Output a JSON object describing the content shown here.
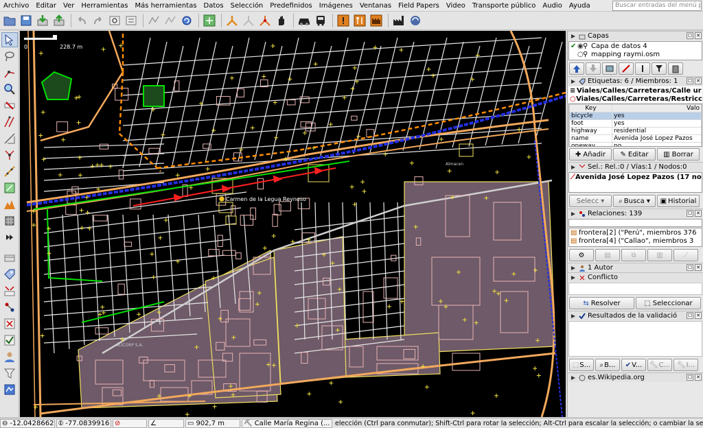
{
  "menubar": {
    "items": [
      "Archivo",
      "Editar",
      "Ver",
      "Herramientas",
      "Más herramientas",
      "Datos",
      "Selección",
      "Predefinidos",
      "Imágenes",
      "Ventanas",
      "Field Papers",
      "Video",
      "Transporte público",
      "Audio",
      "Ayuda"
    ],
    "search_placeholder": "Buscar entradas del menú p"
  },
  "map": {
    "scale_left": "0",
    "scale_right": "228.7 m",
    "labels": {
      "place": "Carmen de la Legua Reynoso",
      "company": "ALICORP S.A.",
      "shop": "Almacen"
    }
  },
  "panels": {
    "layers": {
      "title": "Capas",
      "items": [
        "Capa de datos 4",
        "mapping raymi.osm"
      ]
    },
    "tags": {
      "title": "Etiquetas: 6 / Miembros: 1",
      "presets": [
        "Viales/Calles/Carreteras/Calle ur",
        "Viales/Calles/Carreteras/Restricc"
      ],
      "col_key": "Key",
      "col_value": "Valo",
      "rows": [
        {
          "k": "bicycle",
          "v": "yes"
        },
        {
          "k": "foot",
          "v": "yes"
        },
        {
          "k": "highway",
          "v": "residential"
        },
        {
          "k": "name",
          "v": "Avenida José Lopez Pazos"
        },
        {
          "k": "oneway",
          "v": "no"
        }
      ],
      "btn_add": "Añadir",
      "btn_edit": "Editar",
      "btn_delete": "Borrar"
    },
    "selection": {
      "title": "Sel.: Rel.:0 / Vías:1 / Nodos:0",
      "item": "Avenida José Lopez Pazos (17 nodo",
      "btn_select": "Selecc",
      "btn_search": "Busca",
      "btn_history": "Historial"
    },
    "relations": {
      "title": "Relaciones: 139",
      "items": [
        "frontera[2] (\"Perú\", miembros 376",
        "frontera[4] (\"Callao\", miembros 3"
      ]
    },
    "author": {
      "title": "1 Autor"
    },
    "conflict": {
      "title": "Conflicto",
      "btn_resolve": "Resolver",
      "btn_select": "Seleccionar"
    },
    "validation": {
      "title": "Resultados de la validació",
      "buttons": [
        "S...",
        "B...",
        "V...",
        "C...",
        "I..."
      ]
    },
    "wikipedia": {
      "title": "es.Wikipedia.org"
    }
  },
  "statusbar": {
    "lat": "-12.0428662",
    "lon": "-77.0839916",
    "distance": "902,7 m",
    "street": "Calle María Regina (...",
    "help": "elección (Ctrl para conmutar); Shift-Ctrl para rotar la selección; Alt-Ctrl para escalar la selección; o cambiar la selecció"
  },
  "colors": {
    "map_bg": "#000000",
    "road_outline": "#e8e8e8",
    "primary_road": "#f3a95c",
    "railway": "#2430e0",
    "boundary": "#ff8c00",
    "building": "#e8b4b4",
    "industrial": "#786070",
    "selection": "#ff2020",
    "park_green": "#00e000"
  }
}
